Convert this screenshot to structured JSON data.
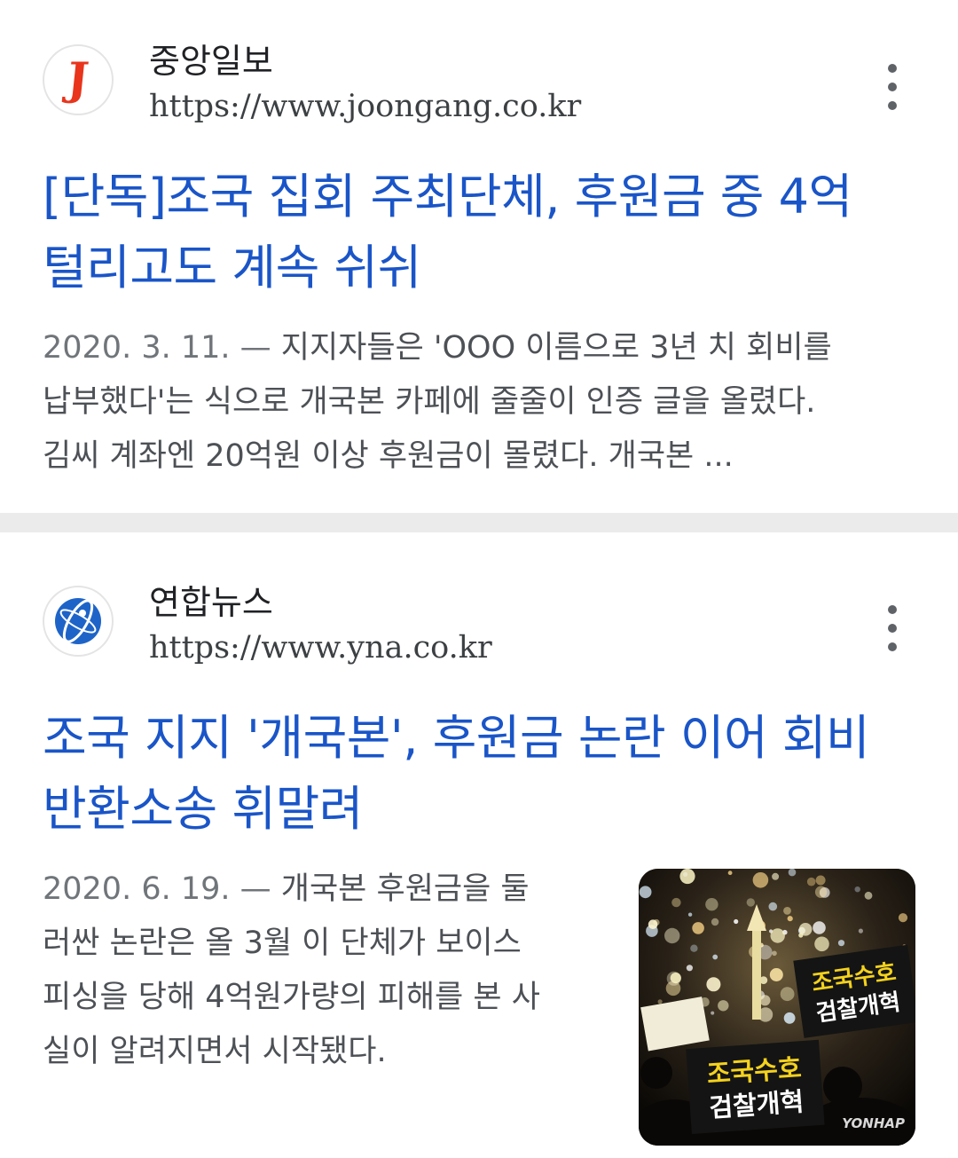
{
  "results": [
    {
      "source_name": "중앙일보",
      "source_url": "https://www.joongang.co.kr",
      "favicon_letter": "J",
      "favicon_color": "#e8351c",
      "title_lines": [
        "[단독]조국 집회 주최단체, 후원금 중 4억",
        "털리고도 계속 쉬쉬"
      ],
      "date": "2020. 3. 11. — ",
      "snippet_lines": [
        "지지자들은 'OOO 이름으로 3년 치 회비를",
        "납부했다'는 식으로 개국본 카페에 줄줄이 인증 글을 올렸다.",
        "김씨 계좌엔 20억원 이상 후원금이 몰렸다. 개국본 ..."
      ]
    },
    {
      "source_name": "연합뉴스",
      "source_url": "https://www.yna.co.kr",
      "favicon_icon": "yonhap-logo-icon",
      "favicon_color": "#1e64c8",
      "title_lines": [
        "조국 지지 '개국본', 후원금 논란 이어 회비",
        "반환소송 휘말려"
      ],
      "date": "2020. 6. 19. — ",
      "snippet_lines": [
        "개국본 후원금을 둘",
        "러싼 논란은 올 3월 이 단체가 보이스",
        "피싱을 당해 4억원가량의 피해를 본 사",
        "실이 알려지면서 시작됐다."
      ],
      "thumbnail": {
        "sign_top": "조국수호\n검찰개혁",
        "sign_bottom": "조국수호\n검찰개혁",
        "watermark": "YONHAP"
      }
    }
  ],
  "colors": {
    "title_link": "#1a55c8",
    "separator": "#ebebeb"
  }
}
